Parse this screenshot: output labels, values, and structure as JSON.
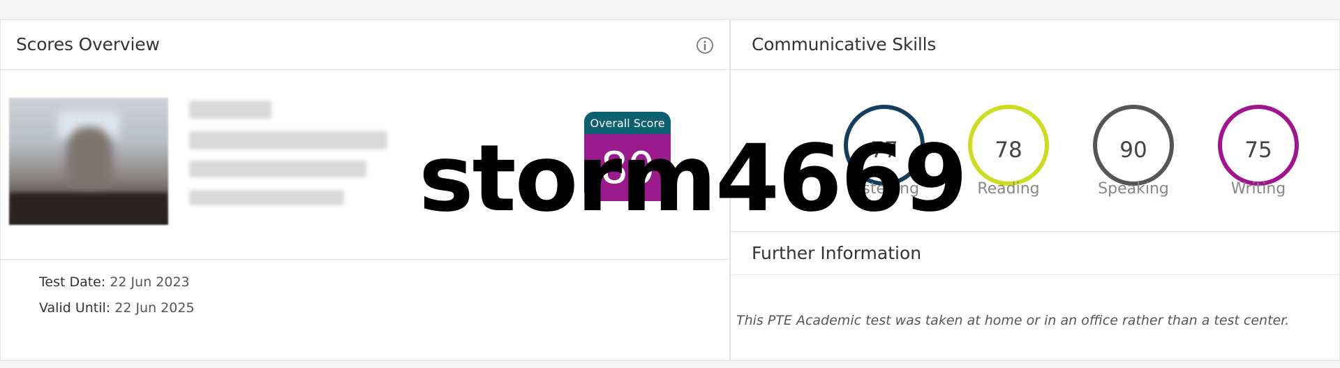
{
  "scores_overview": {
    "title": "Scores Overview",
    "info_icon": "info-circle-icon",
    "overall": {
      "label": "Overall Score",
      "value": "80",
      "header_color": "#0b6170",
      "value_color": "#9a1b8c"
    },
    "test_date_label": "Test Date:",
    "test_date_value": "22 Jun 2023",
    "valid_until_label": "Valid Until:",
    "valid_until_value": "22 Jun 2025"
  },
  "communicative_skills": {
    "title": "Communicative Skills",
    "skills": [
      {
        "label": "Listening",
        "score": "77",
        "color": "#153d5e"
      },
      {
        "label": "Reading",
        "score": "78",
        "color": "#cedc1f"
      },
      {
        "label": "Speaking",
        "score": "90",
        "color": "#555555"
      },
      {
        "label": "Writing",
        "score": "75",
        "color": "#a0148e"
      }
    ]
  },
  "further_information": {
    "title": "Further Information",
    "text": "This PTE Academic test was taken at home or in an office rather than a test center."
  },
  "watermark": "storm4669"
}
